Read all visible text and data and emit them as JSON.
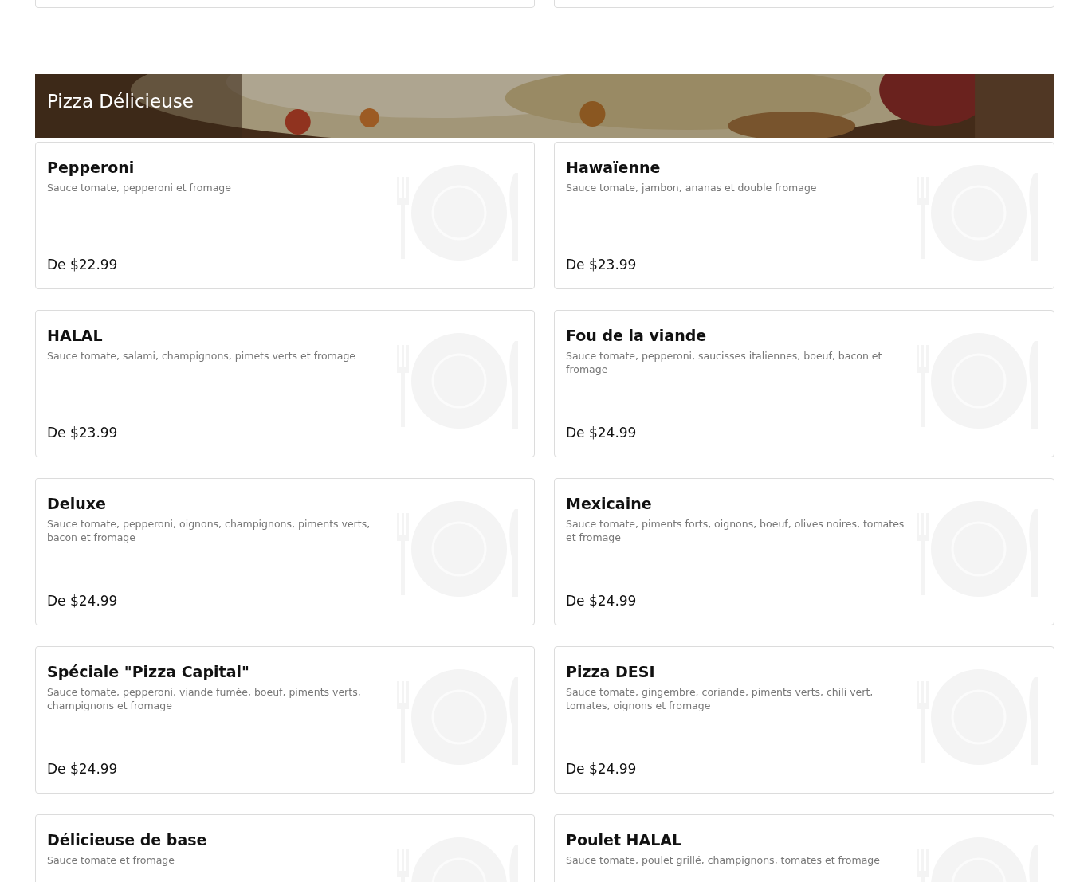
{
  "section": {
    "title": "Pizza Délicieuse"
  },
  "items": [
    {
      "name": "Pepperoni",
      "description": "Sauce tomate, pepperoni et fromage",
      "price": "De $22.99"
    },
    {
      "name": "Hawaïenne",
      "description": "Sauce tomate, jambon, ananas et double fromage",
      "price": "De $23.99"
    },
    {
      "name": "HALAL",
      "description": "Sauce tomate, salami, champignons, pimets verts et fromage",
      "price": "De $23.99"
    },
    {
      "name": "Fou de la viande",
      "description": "Sauce tomate, pepperoni, saucisses italiennes, boeuf, bacon et fromage",
      "price": "De $24.99"
    },
    {
      "name": "Deluxe",
      "description": "Sauce tomate, pepperoni, oignons, champignons, piments verts, bacon et fromage",
      "price": "De $24.99"
    },
    {
      "name": "Mexicaine",
      "description": "Sauce tomate, piments forts, oignons, boeuf, olives noires, tomates et fromage",
      "price": "De $24.99"
    },
    {
      "name": "Spéciale \"Pizza Capital\"",
      "description": "Sauce tomate, pepperoni, viande fumée, boeuf, piments verts, champignons et fromage",
      "price": "De $24.99"
    },
    {
      "name": "Pizza DESI",
      "description": "Sauce tomate, gingembre, coriande, piments verts, chili vert, tomates, oignons et fromage",
      "price": "De $24.99"
    },
    {
      "name": "Délicieuse de base",
      "description": "Sauce tomate et fromage"
    },
    {
      "name": "Poulet HALAL",
      "description": "Sauce tomate, poulet grillé, champignons, tomates et fromage"
    }
  ]
}
